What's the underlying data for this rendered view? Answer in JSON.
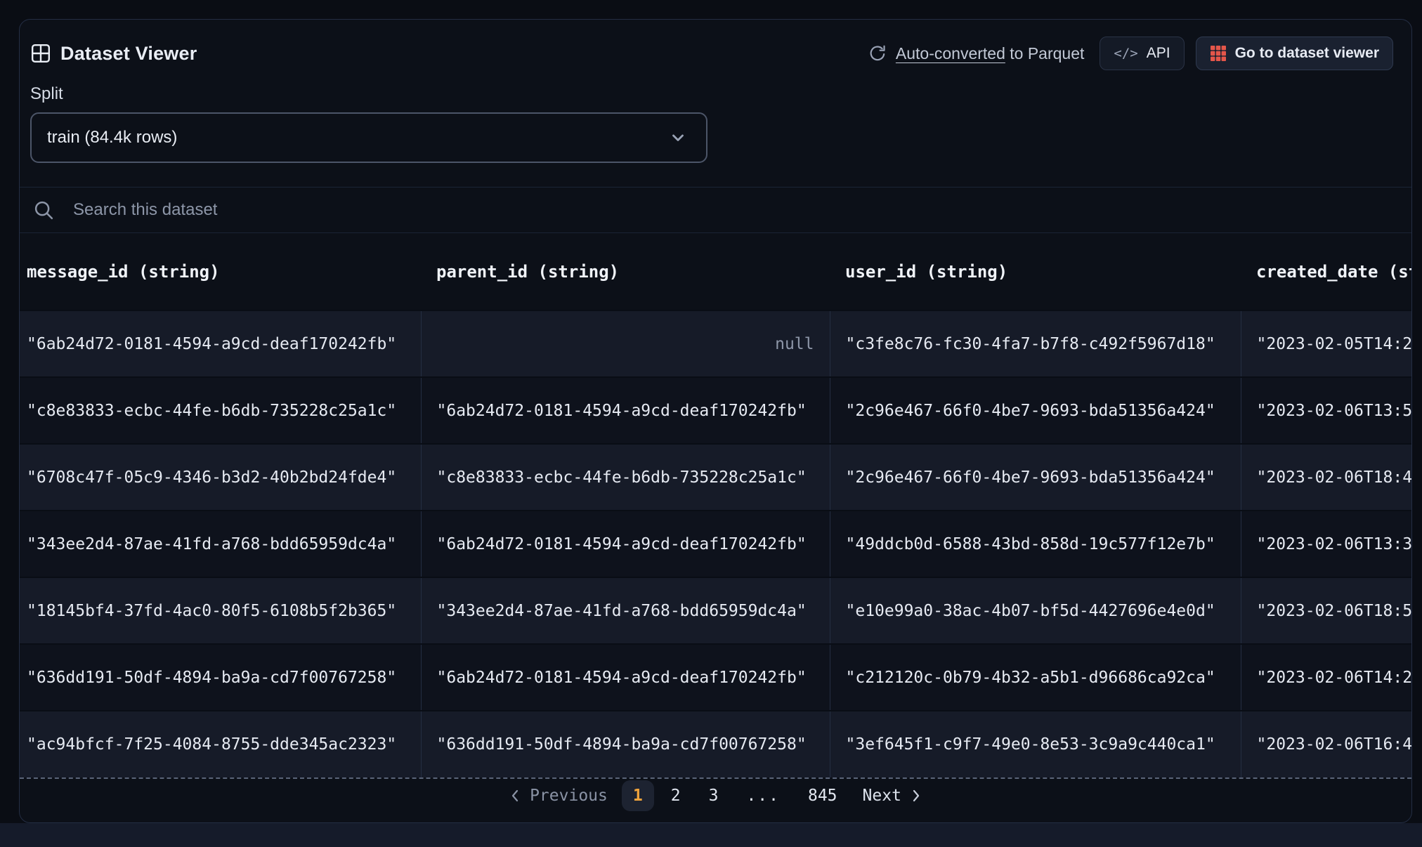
{
  "card": {
    "title": "Dataset Viewer"
  },
  "toolbar": {
    "auto_converted_link": "Auto-converted",
    "auto_converted_suffix": " to Parquet",
    "api_icon_glyph": "</>",
    "api_label": "API",
    "go_to_viewer_label": "Go to dataset viewer"
  },
  "split": {
    "label": "Split",
    "selected_option": "train (84.4k rows)"
  },
  "search": {
    "placeholder": "Search this dataset"
  },
  "table": {
    "null_display": "null",
    "columns": [
      "message_id (string)",
      "parent_id (string)",
      "user_id (string)",
      "created_date (st"
    ],
    "rows": [
      [
        "\"6ab24d72-0181-4594-a9cd-deaf170242fb\"",
        null,
        "\"c3fe8c76-fc30-4fa7-b7f8-c492f5967d18\"",
        "\"2023-02-05T14:2"
      ],
      [
        "\"c8e83833-ecbc-44fe-b6db-735228c25a1c\"",
        "\"6ab24d72-0181-4594-a9cd-deaf170242fb\"",
        "\"2c96e467-66f0-4be7-9693-bda51356a424\"",
        "\"2023-02-06T13:5"
      ],
      [
        "\"6708c47f-05c9-4346-b3d2-40b2bd24fde4\"",
        "\"c8e83833-ecbc-44fe-b6db-735228c25a1c\"",
        "\"2c96e467-66f0-4be7-9693-bda51356a424\"",
        "\"2023-02-06T18:4"
      ],
      [
        "\"343ee2d4-87ae-41fd-a768-bdd65959dc4a\"",
        "\"6ab24d72-0181-4594-a9cd-deaf170242fb\"",
        "\"49ddcb0d-6588-43bd-858d-19c577f12e7b\"",
        "\"2023-02-06T13:3"
      ],
      [
        "\"18145bf4-37fd-4ac0-80f5-6108b5f2b365\"",
        "\"343ee2d4-87ae-41fd-a768-bdd65959dc4a\"",
        "\"e10e99a0-38ac-4b07-bf5d-4427696e4e0d\"",
        "\"2023-02-06T18:5"
      ],
      [
        "\"636dd191-50df-4894-ba9a-cd7f00767258\"",
        "\"6ab24d72-0181-4594-a9cd-deaf170242fb\"",
        "\"c212120c-0b79-4b32-a5b1-d96686ca92ca\"",
        "\"2023-02-06T14:2"
      ],
      [
        "\"ac94bfcf-7f25-4084-8755-dde345ac2323\"",
        "\"636dd191-50df-4894-ba9a-cd7f00767258\"",
        "\"3ef645f1-c9f7-49e0-8e53-3c9a9c440ca1\"",
        "\"2023-02-06T16:4"
      ]
    ]
  },
  "pagination": {
    "previous_label": "Previous",
    "next_label": "Next",
    "pages": [
      "1",
      "2",
      "3",
      "...",
      "845"
    ],
    "current_page": "1"
  },
  "colors": {
    "accent_orange": "#f0a33c",
    "viewer_icon_red": "#e4564a",
    "card_background": "#0c1018",
    "row_light": "#161b28",
    "row_dark": "#0e121c"
  }
}
